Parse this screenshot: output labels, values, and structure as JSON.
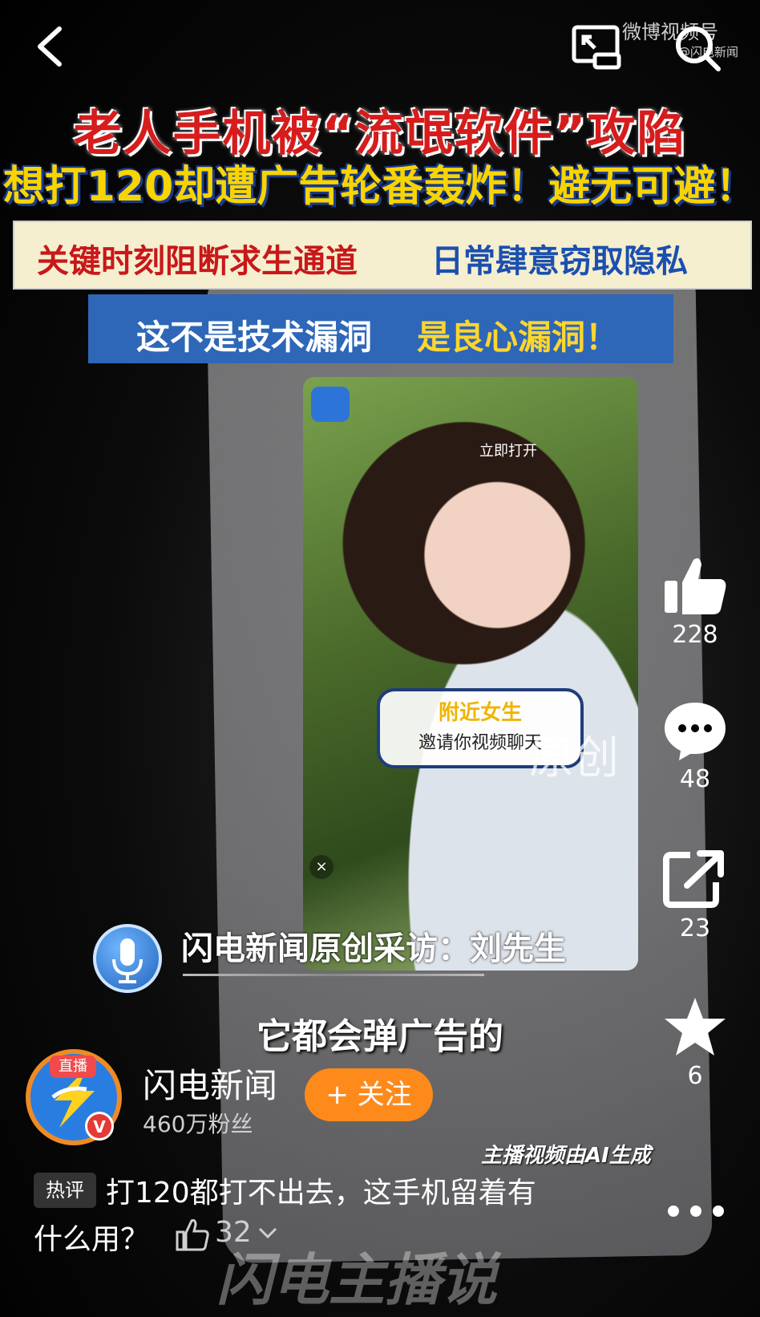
{
  "topbar": {
    "brand": "微博视频号",
    "brand_sub": "@闪电新闻"
  },
  "headline": {
    "line1": "老人手机被“流氓软件”攻陷",
    "line2": "想打120却遭广告轮番轰炸！避无可避！",
    "line3_a": "关键时刻阻断求生通道",
    "line3_b": "日常肆意窃取隐私",
    "line4_a": "这不是技术漏洞",
    "line4_b": "是良心漏洞！"
  },
  "video": {
    "popup_open_label": "立即打开",
    "bubble_title": "附近女生",
    "bubble_text": "邀请你视频聊天",
    "watermark": "原创",
    "interview_caption": "闪电新闻原创采访：刘先生",
    "subtitle": "它都会弹广告的",
    "ai_notice": "主播视频由AI生成",
    "brand_watermark": "闪电主播说"
  },
  "actions": {
    "likes": "228",
    "comments": "48",
    "shares": "23",
    "favorites": "6"
  },
  "account": {
    "live_badge": "直播",
    "name": "闪电新闻",
    "fans": "460万粉丝",
    "follow_label": "+ 关注"
  },
  "hot_comment": {
    "tag": "热评",
    "text_line1": "打120都打不出去，这手机留着有",
    "text_line2": "什么用？",
    "like_count": "32"
  },
  "colors": {
    "follow_bg": "#ff8a1c",
    "headline_red": "#d61c1c",
    "headline_yellow": "#f8d400",
    "banner_blue": "#2e67b8"
  }
}
